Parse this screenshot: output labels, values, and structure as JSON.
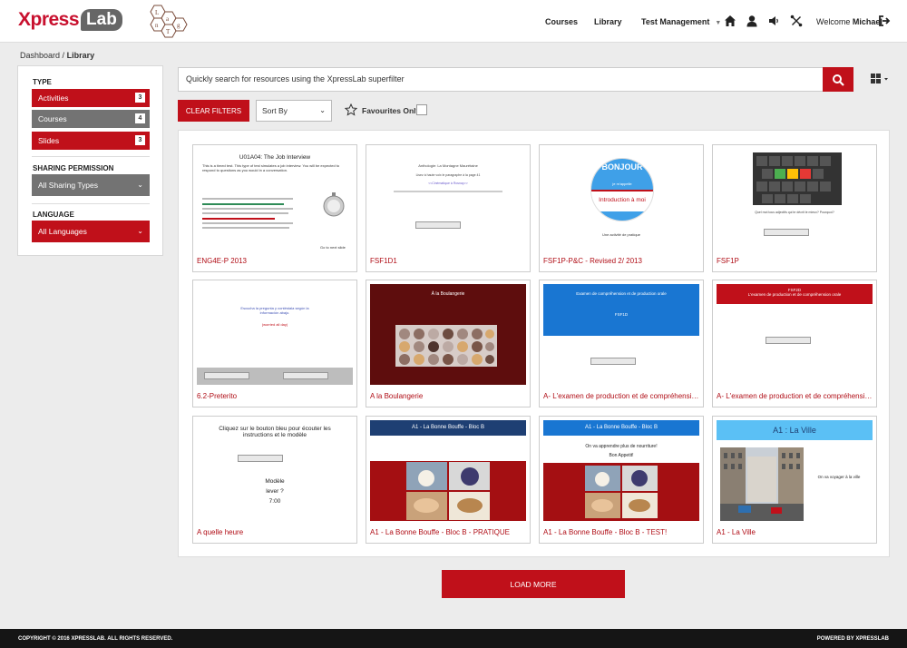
{
  "header": {
    "logo_main": "Xpress",
    "logo_lab": "Lab",
    "logo2_letters": "L a n g T e s t",
    "nav": {
      "courses": "Courses",
      "library": "Library",
      "test_management": "Test Management"
    },
    "welcome_prefix": "Welcome",
    "user_name": "Michael",
    "accent": "#c0101a"
  },
  "breadcrumb": {
    "dashboard": "Dashboard",
    "separator": "/",
    "current": "Library"
  },
  "sidebar": {
    "type_title": "TYPE",
    "types": [
      {
        "label": "Activities",
        "count": "3"
      },
      {
        "label": "Courses",
        "count": "4"
      },
      {
        "label": "Slides",
        "count": "3"
      }
    ],
    "sharing_title": "SHARING PERMISSION",
    "sharing_value": "All Sharing Types",
    "language_title": "LANGUAGE",
    "language_value": "All Languages"
  },
  "search": {
    "placeholder": "Quickly search for resources using the XpressLab superfilter"
  },
  "filters": {
    "clear_label": "CLEAR FILTERS",
    "sort_label": "Sort By",
    "favourites_label": "Favourites Only"
  },
  "cards": [
    {
      "title": "ENG4E-P 2013",
      "thumb_heading": "U01A04: The Job Interview",
      "thumb_text": "This is a timed test. This type of test simulates a job interview. You will be expected to respond to questions as you would in a conversation.",
      "thumb_link": "Go to next slide"
    },
    {
      "title": "FSF1D1",
      "thumb_heading": "Anthologie: La Montagne Maurétaine",
      "thumb_text": "Lisez à haute voix le paragraphe à la page 41",
      "thumb_link": "<<Cinématique à Rosnay>>"
    },
    {
      "title": "FSF1P-P&C - Revised 2/ 2013",
      "thumb_heading": "BONJOUR",
      "thumb_sub": "je m'appelle",
      "thumb_band": "Introduction à moi",
      "thumb_text": "Une activité de pratique"
    },
    {
      "title": "FSF1P",
      "thumb_text": "Quel mot tous adjectifs qui te décrit le mieux? Pourquoi?"
    },
    {
      "title": "6.2-Preterito",
      "thumb_heading": "Escucha la pregunta y contéstala según la información abajo.",
      "thumb_sub": "(worried all day)"
    },
    {
      "title": "A la Boulangerie",
      "thumb_heading": "À la Boulangerie"
    },
    {
      "title": "A- L'examen de production et de compréhension orale",
      "thumb_heading": "Examen de compréhension et de production orale",
      "thumb_sub": "FSF1D"
    },
    {
      "title": "A- L'examen de production et de compréhension orale",
      "thumb_heading": "FSF2D",
      "thumb_sub": "L'examen de production et de compréhension orale"
    },
    {
      "title": "A quelle heure",
      "thumb_heading": "Cliquez sur le bouton bleu pour écouter les instructions et le modèle",
      "thumb_text": "Modèle",
      "thumb_sub": "lever ?",
      "thumb_time": "7:00"
    },
    {
      "title": "A1 - La Bonne Bouffe - Bloc B - PRATIQUE",
      "thumb_heading": "A1 - La Bonne Bouffe - Bloc B"
    },
    {
      "title": "A1 - La Bonne Bouffe - Bloc B - TEST!",
      "thumb_heading": "A1 - La Bonne Bouffe - Bloc B",
      "thumb_text": "On va apprendre plus de nourriture!",
      "thumb_sub": "Bon Appetit!"
    },
    {
      "title": "A1 - La Ville",
      "thumb_heading": "A1 : La Ville",
      "thumb_text": "On va voyager à la ville"
    }
  ],
  "load_more": "LOAD MORE",
  "footer": {
    "left": "COPYRIGHT © 2016 XPRESSLAB. ALL RIGHTS RESERVED.",
    "right": "POWERED BY XPRESSLAB"
  }
}
